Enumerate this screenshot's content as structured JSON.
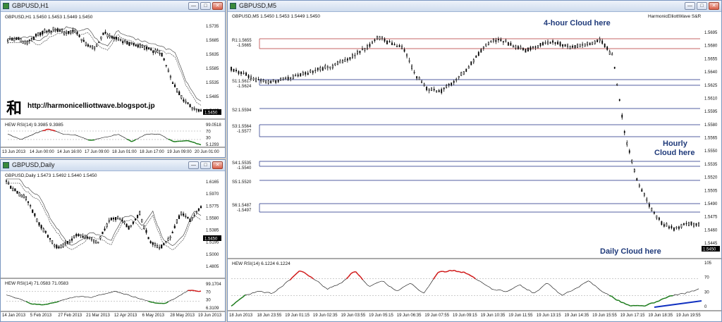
{
  "windows": {
    "h1": {
      "title": "GBPUSD,H1",
      "header": "GBPUSD,H1  1.5450 1.5453 1.5449 1.5450",
      "price_ticks": [
        "1.5735",
        "1.5685",
        "1.5635",
        "1.5585",
        "1.5535",
        "1.5485",
        "1.5435"
      ],
      "current_price": "1.5450",
      "watermark_glyph": "和",
      "url": "http://harmonicelliottwave.blogspot.jp",
      "rsi_header": "HEW RSI(14) 9.3985 9.3985",
      "rsi_ticks": [
        "99.0518",
        "70",
        "30",
        "5.1293"
      ],
      "time_ticks": [
        "13 Jun 2013",
        "14 Jun 00:00",
        "14 Jun 16:00",
        "17 Jun 09:00",
        "18 Jun 01:00",
        "18 Jun 17:00",
        "19 Jun 09:00",
        "20 Jun 01:00"
      ]
    },
    "daily": {
      "title": "GBPUSD,Daily",
      "header": "GBPUSD,Daily  1.5473 1.5492 1.5440 1.5450",
      "price_ticks": [
        "1.6165",
        "1.5970",
        "1.5775",
        "1.5580",
        "1.5385",
        "1.5195",
        "1.5000",
        "1.4805"
      ],
      "current_price": "1.5450",
      "rsi_header": "HEW RSI(14) 71.0583 71.0583",
      "rsi_ticks": [
        "99.1704",
        "70",
        "30",
        "6.3109"
      ],
      "time_ticks": [
        "14 Jan 2013",
        "5 Feb 2013",
        "27 Feb 2013",
        "21 Mar 2013",
        "12 Apr 2013",
        "6 May 2013",
        "28 May 2013",
        "19 Jun 2013"
      ]
    },
    "m5": {
      "title": "GBPUSD,M5",
      "header": "GBPUSD,M5  1.5450 1.5453 1.5449 1.5450",
      "indicator_label": "HarmonicElliottWave S&R",
      "price_ticks": [
        "1.5695",
        "1.5680",
        "1.5655",
        "1.5640",
        "1.5625",
        "1.5610",
        "1.5595",
        "1.5580",
        "1.5565",
        "1.5550",
        "1.5535",
        "1.5520",
        "1.5505",
        "1.5490",
        "1.5475",
        "1.5460",
        "1.5445"
      ],
      "current_price": "1.5450",
      "levels": [
        {
          "name": "R1",
          "line1": "R1:1.5655",
          "line2": "-1.5665",
          "color": "#b03030"
        },
        {
          "name": "S1",
          "line1": "S1:1.5617",
          "line2": "-1.5624",
          "color": "#1a2a80"
        },
        {
          "name": "S2",
          "line1": "S2:1.5594",
          "line2": "",
          "color": "#1a2a80"
        },
        {
          "name": "S3",
          "line1": "S3:1.5564",
          "line2": "-1.5577",
          "color": "#1a2a80"
        },
        {
          "name": "S4",
          "line1": "S4:1.5535",
          "line2": "-1.5540",
          "color": "#1a2a80"
        },
        {
          "name": "S5",
          "line1": "S5:1.5520",
          "line2": "",
          "color": "#1a2a80"
        },
        {
          "name": "S6",
          "line1": "S6:1.5487",
          "line2": "-1.5497",
          "color": "#1a2a80"
        }
      ],
      "annotations": {
        "four_hour": "4-hour Cloud  here",
        "hourly_1": "Hourly",
        "hourly_2": "Cloud  here",
        "daily": "Daily Cloud  here"
      },
      "rsi_header": "HEW RSI(14) 6.1224 6.1224",
      "rsi_ticks": [
        "105",
        "70",
        "30",
        "0"
      ],
      "time_ticks": [
        "18 Jun 2013",
        "18 Jun 23:55",
        "19 Jun 01:15",
        "19 Jun 02:35",
        "19 Jun 03:55",
        "19 Jun 05:15",
        "19 Jun 06:35",
        "19 Jun 07:55",
        "19 Jun 09:15",
        "19 Jun 10:35",
        "19 Jun 11:55",
        "19 Jun 13:15",
        "19 Jun 14:35",
        "19 Jun 15:55",
        "19 Jun 17:15",
        "19 Jun 18:35",
        "19 Jun 19:55"
      ]
    }
  },
  "colors": {
    "rsi_high": "#d01818",
    "rsi_low": "#1a7a1a",
    "trend": "#1030c0",
    "cloud": "#333333"
  },
  "icons": {
    "window": "chart-window-icon",
    "minimize": "minimize-icon",
    "maximize": "maximize-icon",
    "close": "close-icon"
  }
}
